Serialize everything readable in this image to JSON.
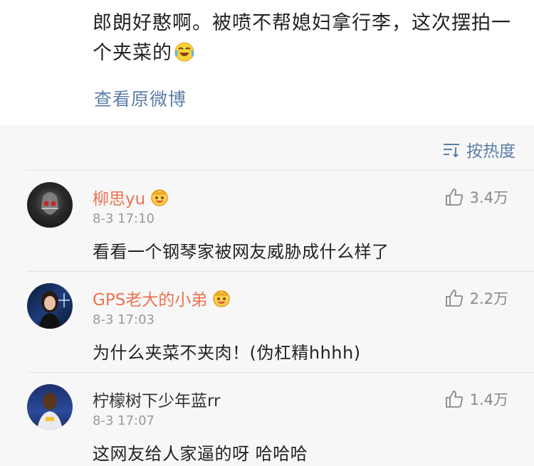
{
  "post": {
    "text": "郎朗好憨啊。被喷不帮媳妇拿行李，这次摆拍一个夹菜的",
    "emoji_icon": "laughing-tears-icon",
    "view_original": "查看原微博"
  },
  "sort": {
    "label": "按热度",
    "icon": "sort-icon"
  },
  "colors": {
    "accent": "#5b7ea6",
    "vip_name": "#eb7350"
  },
  "comments": [
    {
      "name": "柳思yu",
      "vip": true,
      "time": "8-3 17:10",
      "text": "看看一个钢琴家被网友威胁成什么样了",
      "likes": "3.4万"
    },
    {
      "name": "GPS老大的小弟",
      "vip": true,
      "time": "8-3 17:03",
      "text": "为什么夹菜不夹肉！(伪杠精hhhh)",
      "likes": "2.2万"
    },
    {
      "name": "柠檬树下少年蓝rr",
      "vip": false,
      "time": "8-3 17:07",
      "text": "这网友给人家逼的呀 哈哈哈",
      "likes": "1.4万"
    }
  ]
}
